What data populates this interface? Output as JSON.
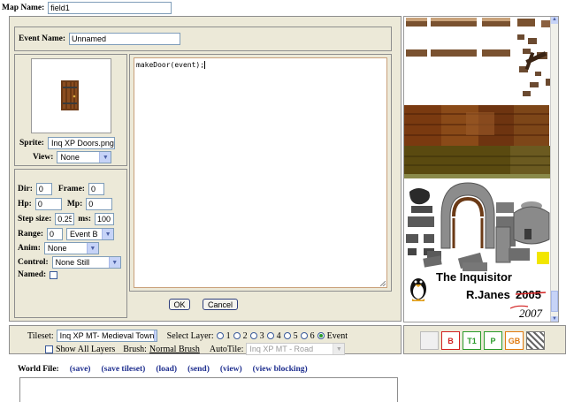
{
  "map_name": {
    "label": "Map Name:",
    "value": "field1"
  },
  "event_name": {
    "label": "Event Name:",
    "value": "Unnamed"
  },
  "sprite": {
    "label": "Sprite:",
    "value": "Inq XP Doors.png"
  },
  "view": {
    "label": "View:",
    "value": "None"
  },
  "props": {
    "dir_label": "Dir:",
    "dir": "0",
    "frame_label": "Frame:",
    "frame": "0",
    "hp_label": "Hp:",
    "hp": "0",
    "mp_label": "Mp:",
    "mp": "0",
    "step_label": "Step size:",
    "step": "0.25",
    "ms_label": "ms:",
    "ms": "100",
    "range_label": "Range:",
    "range": "0",
    "range_event": "Event B",
    "anim_label": "Anim:",
    "anim": "None",
    "control_label": "Control:",
    "control": "None Still",
    "named_label": "Named:"
  },
  "code": "makeDoor(event);",
  "buttons": {
    "ok": "OK",
    "cancel": "Cancel"
  },
  "tileset_text": {
    "title": "The Inquisitor",
    "author": "R.Janes",
    "year_old": "2005",
    "year_new": "2007"
  },
  "toolbar": {
    "tileset_label": "Tileset:",
    "tileset": "Inq XP MT- Medieval Town",
    "layer_label": "Select Layer:",
    "layers": [
      "1",
      "2",
      "3",
      "4",
      "5",
      "6",
      "Event"
    ],
    "selected_layer": "Event",
    "show_all": "Show All Layers",
    "brush_label": "Brush:",
    "brush": "Normal Brush",
    "autotile_label": "AutoTile:",
    "autotile": "Inq XP MT - Road"
  },
  "tools": [
    {
      "label": "",
      "color": "#d9d9d9"
    },
    {
      "label": "B",
      "color": "#d22020"
    },
    {
      "label": "T1",
      "color": "#2a9a2a"
    },
    {
      "label": "P",
      "color": "#2a9a2a"
    },
    {
      "label": "GB",
      "color": "#e07a10"
    },
    {
      "label": "",
      "color": "#7a7a7a"
    }
  ],
  "world_file": {
    "label": "World File:",
    "links": [
      "(save)",
      "(save tileset)",
      "(load)",
      "(send)",
      "(view)",
      "(view blocking)"
    ]
  }
}
